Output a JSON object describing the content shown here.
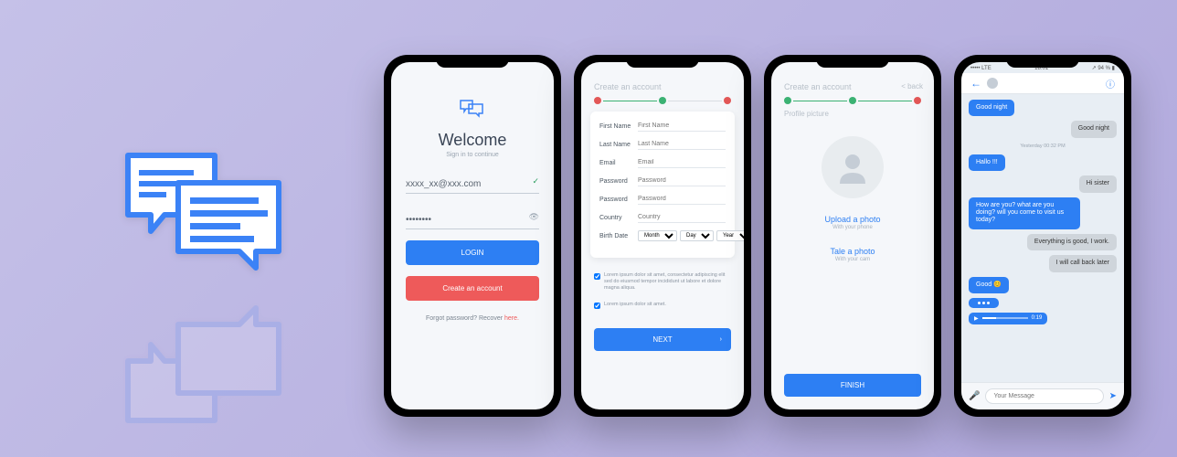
{
  "login": {
    "welcome": "Welcome",
    "signin": "Sign in to continue",
    "email": "xxxx_xx@xxx.com",
    "password": "********",
    "login_btn": "LOGIN",
    "create_btn": "Create an account",
    "forgot": "Forgot password?  Recover",
    "here": "here."
  },
  "create": {
    "header": "Create an account",
    "fields": {
      "first_name": {
        "label": "First Name",
        "ph": "First Name"
      },
      "last_name": {
        "label": "Last Name",
        "ph": "Last Name"
      },
      "email": {
        "label": "Email",
        "ph": "Email"
      },
      "password": {
        "label": "Password",
        "ph": "Password"
      },
      "password2": {
        "label": "Password",
        "ph": "Password"
      },
      "country": {
        "label": "Country",
        "ph": "Country"
      },
      "birth": {
        "label": "Birth Date"
      }
    },
    "selects": {
      "month": "Month",
      "day": "Day",
      "year": "Year"
    },
    "terms": "Lorem ipsum dolor sit amet, consectetur adipiscing elit sed do eiusmod tempor incididunt ut labore et dolore magna aliqua.",
    "terms2": "Lorem ipsum dolor sit amet.",
    "next": "NEXT"
  },
  "profile": {
    "header": "Create an account",
    "back": "< back",
    "section": "Profile picture",
    "upload": "Upload a photo",
    "upload_sub": "With your phone",
    "take": "Tale a photo",
    "take_sub": "With your cam",
    "finish": "FINISH"
  },
  "chat": {
    "status": {
      "carrier": "••••• LTE",
      "time": "18:01",
      "battery": "94 %"
    },
    "back_icon": "←",
    "timestamp": "Yesterday 00:32 PM",
    "messages": [
      {
        "text": "Good night",
        "sent": true
      },
      {
        "text": "Good night",
        "sent": false
      },
      {
        "text": "Hallo !!!",
        "sent": true
      },
      {
        "text": "Hi sister",
        "sent": false
      },
      {
        "text": "How are you? what are you doing? will you come to visit us today?",
        "sent": true
      },
      {
        "text": "Everything is good, I work.",
        "sent": false
      },
      {
        "text": "I will call back later",
        "sent": false
      },
      {
        "text": "Good  😊",
        "sent": true
      }
    ],
    "audio_time": "0:19",
    "input_ph": "Your Message"
  }
}
